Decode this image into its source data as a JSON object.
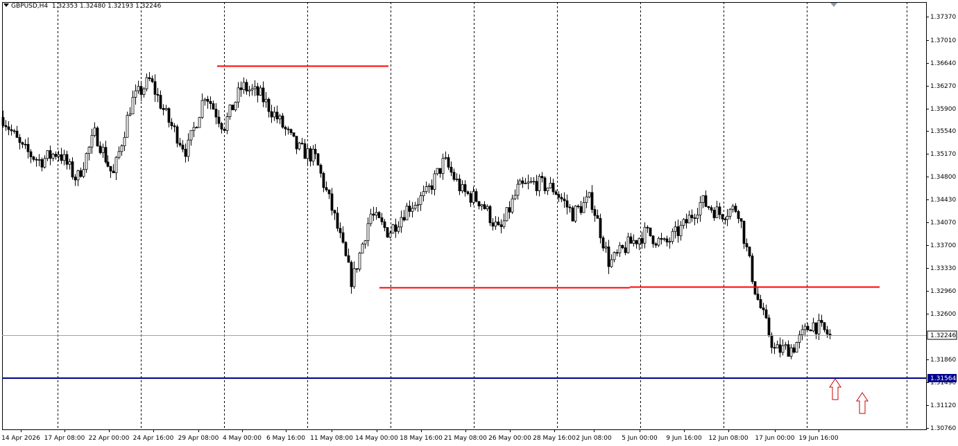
{
  "symbol_info": {
    "symbol": "GBPUSD,H4",
    "ohlc": "1.32353 1.32480 1.32193 1.32246"
  },
  "colors": {
    "background": "#ffffff",
    "candles": "#000000",
    "grid": "#000000",
    "resistance_lines": "#ff0000",
    "support_line": "#00008b",
    "current_price_line": "#a0a0a0",
    "arrows": "#cc0000"
  },
  "chart_data": {
    "type": "candlestick",
    "symbol": "GBPUSD",
    "timeframe": "H4",
    "grid": true,
    "y_ticks": [
      "1.37370",
      "1.37010",
      "1.36640",
      "1.36270",
      "1.35900",
      "1.35540",
      "1.35170",
      "1.34800",
      "1.34430",
      "1.34070",
      "1.33700",
      "1.33330",
      "1.32960",
      "1.32600",
      "1.31860",
      "1.31490",
      "1.31120",
      "1.30760"
    ],
    "x_labels": [
      "14 Apr 2026",
      "17 Apr 08:00",
      "22 Apr 00:00",
      "24 Apr 16:00",
      "29 Apr 08:00",
      "4 May 00:00",
      "6 May 16:00",
      "11 May 08:00",
      "14 May 00:00",
      "18 May 16:00",
      "21 May 08:00",
      "26 May 00:00",
      "28 May 16:00",
      "2 Jun 08:00",
      "5 Jun 00:00",
      "9 Jun 16:00",
      "12 Jun 08:00",
      "17 Jun 00:00",
      "19 Jun 16:00"
    ],
    "current_price": "1.32246",
    "support_level": "1.31564",
    "horizontal_lines": [
      {
        "role": "resistance",
        "price": 1.3658,
        "from": "1 May 12:00",
        "to": "14 May 16:00"
      },
      {
        "role": "support",
        "price": 1.33,
        "from": "14 May 00:00",
        "to": "24 Jun 00:00"
      },
      {
        "role": "support",
        "price": 1.31564,
        "from": "14 Apr 2026",
        "to": "chart end"
      }
    ],
    "close_path": [
      [
        "14 Apr 2026",
        1.3575
      ],
      [
        "17 Apr",
        1.3525
      ],
      [
        "20 Apr",
        1.3505
      ],
      [
        "22 Apr",
        1.352
      ],
      [
        "24 Apr",
        1.3475
      ],
      [
        "27 Apr",
        1.355
      ],
      [
        "29 Apr",
        1.348
      ],
      [
        "30 Apr",
        1.36
      ],
      [
        "1 May",
        1.3635
      ],
      [
        "4 May",
        1.357
      ],
      [
        "5 May",
        1.352
      ],
      [
        "6 May",
        1.3615
      ],
      [
        "7 May",
        1.356
      ],
      [
        "8 May",
        1.3625
      ],
      [
        "11 May",
        1.361
      ],
      [
        "12 May",
        1.357
      ],
      [
        "13 May",
        1.3525
      ],
      [
        "14 May",
        1.351
      ],
      [
        "15 May",
        1.342
      ],
      [
        "18 May",
        1.331
      ],
      [
        "19 May",
        1.342
      ],
      [
        "20 May",
        1.339
      ],
      [
        "21 May",
        1.343
      ],
      [
        "22 May",
        1.345
      ],
      [
        "25 May",
        1.3505
      ],
      [
        "26 May",
        1.3455
      ],
      [
        "27 May",
        1.344
      ],
      [
        "28 May",
        1.339
      ],
      [
        "29 May",
        1.346
      ],
      [
        "1 Jun",
        1.347
      ],
      [
        "2 Jun",
        1.346
      ],
      [
        "3 Jun",
        1.342
      ],
      [
        "4 Jun",
        1.3445
      ],
      [
        "5 Jun",
        1.334
      ],
      [
        "8 Jun",
        1.337
      ],
      [
        "9 Jun",
        1.339
      ],
      [
        "10 Jun",
        1.337
      ],
      [
        "11 Jun",
        1.34
      ],
      [
        "12 Jun",
        1.344
      ],
      [
        "15 Jun",
        1.342
      ],
      [
        "16 Jun",
        1.343
      ],
      [
        "17 Jun",
        1.329
      ],
      [
        "18 Jun",
        1.32
      ],
      [
        "19 Jun",
        1.3205
      ],
      [
        "22 Jun",
        1.3245
      ],
      [
        "23 Jun",
        1.32246
      ]
    ]
  },
  "markers": [
    {
      "name": "up-arrow-1",
      "direction": "up"
    },
    {
      "name": "up-arrow-2",
      "direction": "up"
    }
  ]
}
